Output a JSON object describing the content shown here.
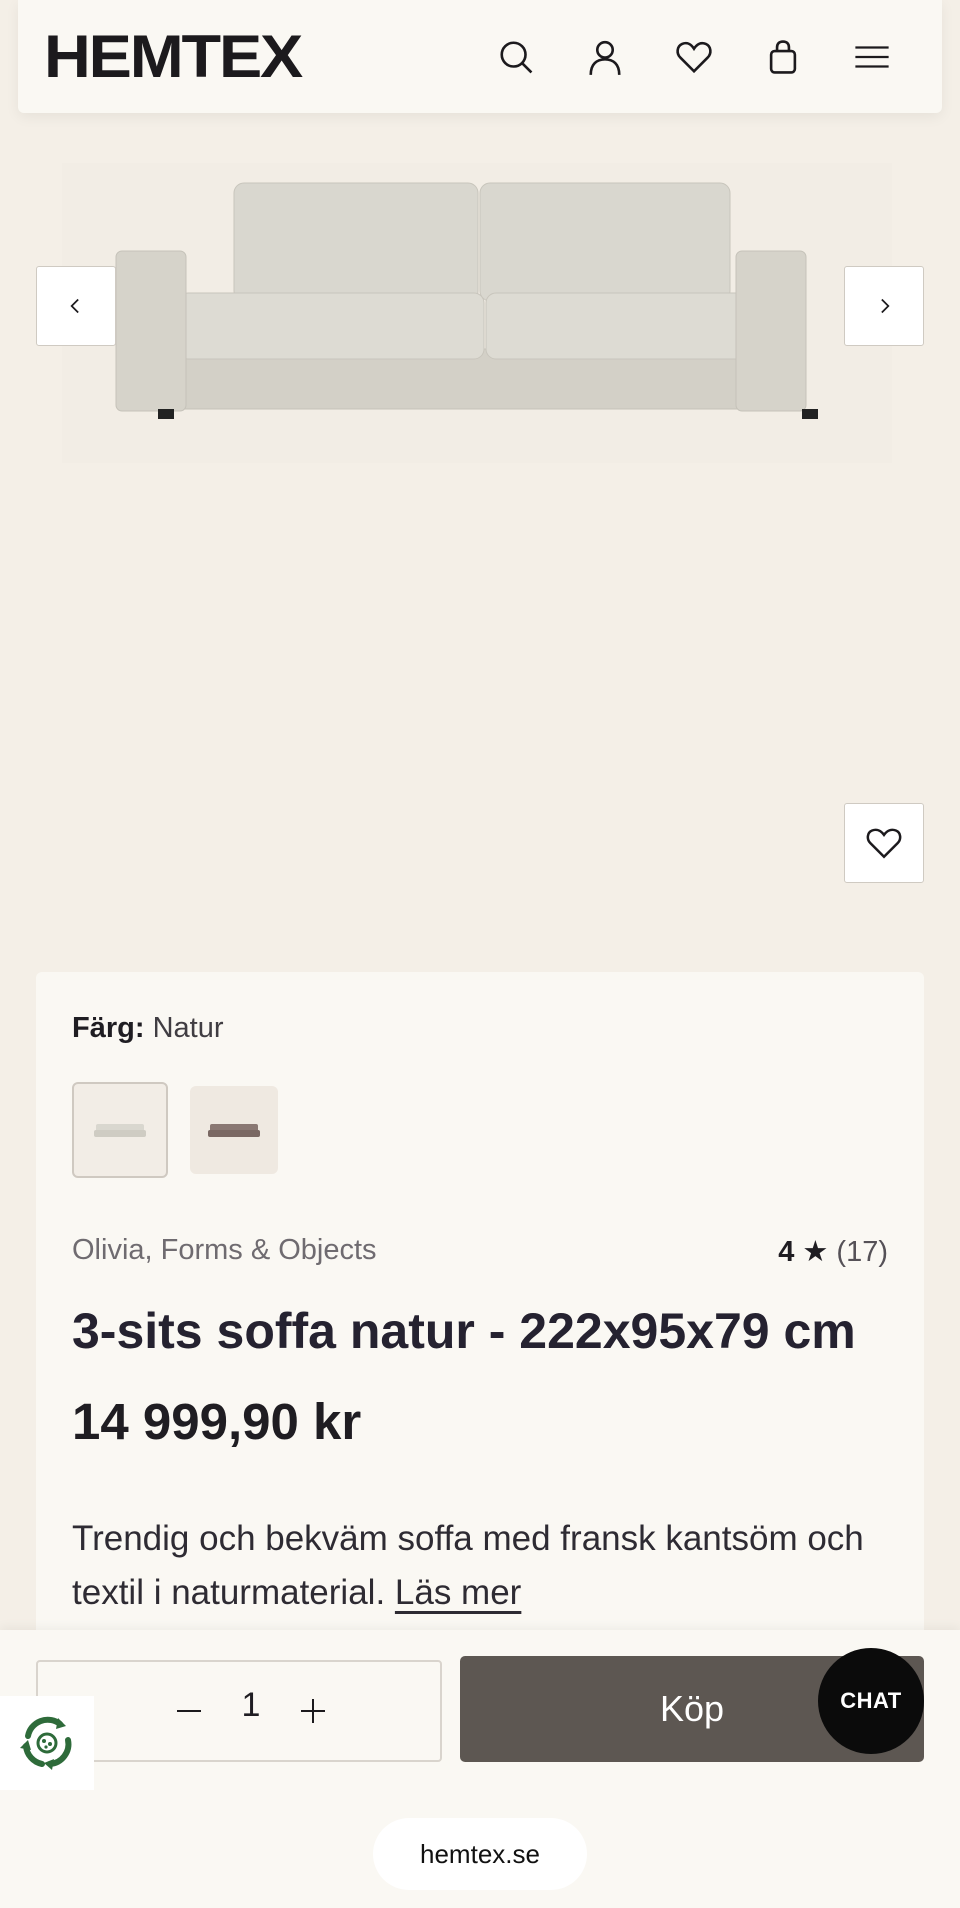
{
  "header": {
    "logo": "HEMTEX",
    "icons": [
      "search-icon",
      "account-icon",
      "wishlist-icon",
      "bag-icon",
      "menu-icon"
    ]
  },
  "gallery": {
    "image_subject": "3-seat sofa, natural color",
    "nav_icons": [
      "chevron-left-icon",
      "chevron-right-icon"
    ],
    "favorite_icon": "heart-icon"
  },
  "product": {
    "color_label": "Färg:",
    "color_value": "Natur",
    "swatches": [
      "Natur",
      "Brown"
    ],
    "brand": "Olivia, Forms & Objects",
    "rating": "4",
    "rating_star": "★",
    "rating_count": "(17)",
    "title": "3-sits soffa natur - 222x95x79 cm",
    "price": "14 999,90 kr",
    "description": "Trendig och bekväm soffa med fransk kantsöm och textil i naturmaterial.",
    "read_more": "Läs mer"
  },
  "buybar": {
    "quantity": "1",
    "buy_label": "Köp",
    "chat_label": "CHAT",
    "site_url": "hemtex.se"
  },
  "colors": {
    "background": "#f4efe7",
    "card": "#faf8f3",
    "buy_button": "#5d5752",
    "chat": "#0b0b0b",
    "eco_green": "#2e6b3a"
  }
}
